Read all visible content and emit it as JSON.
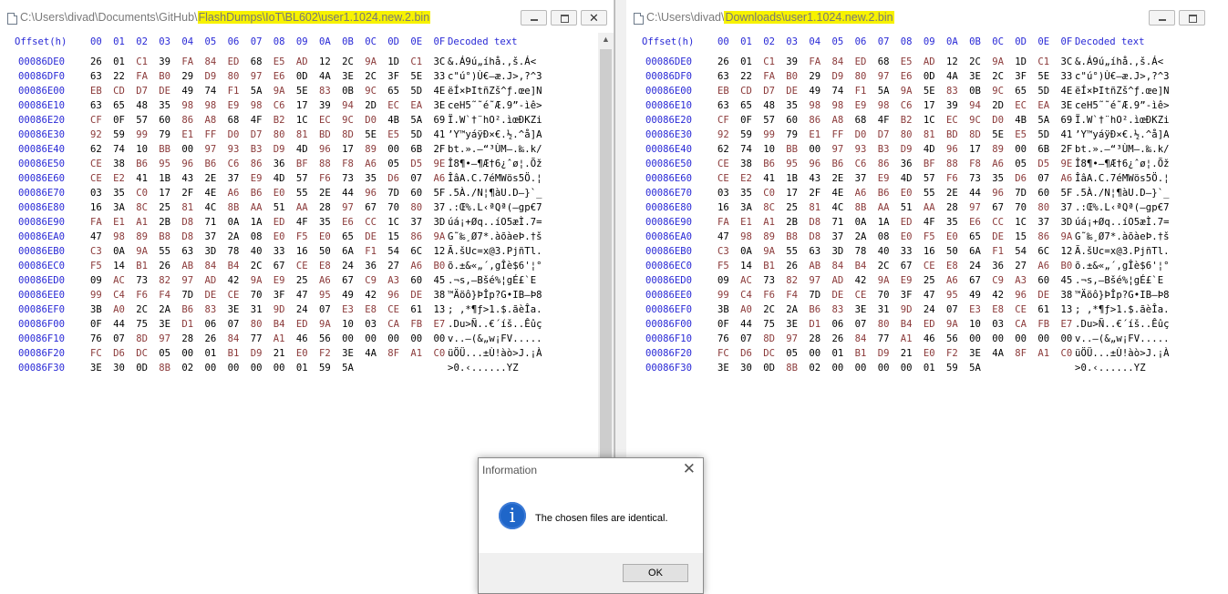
{
  "left_window": {
    "title_prefix": "C:\\Users\\divad\\Documents\\GitHub\\",
    "title_highlight": "FlashDumps\\IoT\\BL602\\user1.1024.new.2.bin"
  },
  "right_window": {
    "title_prefix": "C:\\Users\\divad\\",
    "title_highlight": "Downloads\\user1.1024.new.2.bin"
  },
  "header": {
    "offset": "Offset(h)",
    "columns": [
      "00",
      "01",
      "02",
      "03",
      "04",
      "05",
      "06",
      "07",
      "08",
      "09",
      "0A",
      "0B",
      "0C",
      "0D",
      "0E",
      "0F"
    ],
    "decoded": "Decoded text"
  },
  "rows": [
    {
      "offset": "00086DE0",
      "bytes": [
        "26",
        "01",
        "C1",
        "39",
        "FA",
        "84",
        "ED",
        "68",
        "E5",
        "AD",
        "12",
        "2C",
        "9A",
        "1D",
        "C1",
        "3C"
      ],
      "text": "&.Á9ú„íhå­.,š.Á<"
    },
    {
      "offset": "00086DF0",
      "bytes": [
        "63",
        "22",
        "FA",
        "B0",
        "29",
        "D9",
        "80",
        "97",
        "E6",
        "0D",
        "4A",
        "3E",
        "2C",
        "3F",
        "5E",
        "33"
      ],
      "text": "c\"ú°)Ù€—æ.J>,?^3"
    },
    {
      "offset": "00086E00",
      "bytes": [
        "EB",
        "CD",
        "D7",
        "DE",
        "49",
        "74",
        "F1",
        "5A",
        "9A",
        "5E",
        "83",
        "0B",
        "9C",
        "65",
        "5D",
        "4E"
      ],
      "text": "ëÍ×ÞItñZš^ƒ.œe]N"
    },
    {
      "offset": "00086E10",
      "bytes": [
        "63",
        "65",
        "48",
        "35",
        "98",
        "98",
        "E9",
        "98",
        "C6",
        "17",
        "39",
        "94",
        "2D",
        "EC",
        "EA",
        "3E"
      ],
      "text": "ceH5˜˜é˜Æ.9”-ìê>"
    },
    {
      "offset": "00086E20",
      "bytes": [
        "CF",
        "0F",
        "57",
        "60",
        "86",
        "A8",
        "68",
        "4F",
        "B2",
        "1C",
        "EC",
        "9C",
        "D0",
        "4B",
        "5A",
        "69"
      ],
      "text": "Ï.W`†¨hO².ìœÐKZi"
    },
    {
      "offset": "00086E30",
      "bytes": [
        "92",
        "59",
        "99",
        "79",
        "E1",
        "FF",
        "D0",
        "D7",
        "80",
        "81",
        "BD",
        "8D",
        "5E",
        "E5",
        "5D",
        "41"
      ],
      "text": "’Y™yáÿÐ×€.½.^å]A"
    },
    {
      "offset": "00086E40",
      "bytes": [
        "62",
        "74",
        "10",
        "BB",
        "00",
        "97",
        "93",
        "B3",
        "D9",
        "4D",
        "96",
        "17",
        "89",
        "00",
        "6B",
        "2F"
      ],
      "text": "bt.».—“³ÙM–.‰.k/"
    },
    {
      "offset": "00086E50",
      "bytes": [
        "CE",
        "38",
        "B6",
        "95",
        "96",
        "B6",
        "C6",
        "86",
        "36",
        "BF",
        "88",
        "F8",
        "A6",
        "05",
        "D5",
        "9E"
      ],
      "text": "Î8¶•–¶Æ†6¿ˆø¦.Õž"
    },
    {
      "offset": "00086E60",
      "bytes": [
        "CE",
        "E2",
        "41",
        "1B",
        "43",
        "2E",
        "37",
        "E9",
        "4D",
        "57",
        "F6",
        "73",
        "35",
        "D6",
        "07",
        "A6"
      ],
      "text": "ÎâA.C.7éMWös5Ö.¦"
    },
    {
      "offset": "00086E70",
      "bytes": [
        "03",
        "35",
        "C0",
        "17",
        "2F",
        "4E",
        "A6",
        "B6",
        "E0",
        "55",
        "2E",
        "44",
        "96",
        "7D",
        "60",
        "5F"
      ],
      "text": ".5À./N¦¶àU.D–}`_"
    },
    {
      "offset": "00086E80",
      "bytes": [
        "16",
        "3A",
        "8C",
        "25",
        "81",
        "4C",
        "8B",
        "AA",
        "51",
        "AA",
        "28",
        "97",
        "67",
        "70",
        "80",
        "37"
      ],
      "text": ".:Œ%.L‹ªQª(—gp€7"
    },
    {
      "offset": "00086E90",
      "bytes": [
        "FA",
        "E1",
        "A1",
        "2B",
        "D8",
        "71",
        "0A",
        "1A",
        "ED",
        "4F",
        "35",
        "E6",
        "CC",
        "1C",
        "37",
        "3D"
      ],
      "text": "úá¡+Øq..íO5æÌ.7="
    },
    {
      "offset": "00086EA0",
      "bytes": [
        "47",
        "98",
        "89",
        "B8",
        "D8",
        "37",
        "2A",
        "08",
        "E0",
        "F5",
        "E0",
        "65",
        "DE",
        "15",
        "86",
        "9A"
      ],
      "text": "G˜‰¸Ø7*.àõàeÞ.†š"
    },
    {
      "offset": "00086EB0",
      "bytes": [
        "C3",
        "0A",
        "9A",
        "55",
        "63",
        "3D",
        "78",
        "40",
        "33",
        "16",
        "50",
        "6A",
        "F1",
        "54",
        "6C",
        "12"
      ],
      "text": "Ã.šUc=x@3.PjñTl."
    },
    {
      "offset": "00086EC0",
      "bytes": [
        "F5",
        "14",
        "B1",
        "26",
        "AB",
        "84",
        "B4",
        "2C",
        "67",
        "CE",
        "E8",
        "24",
        "36",
        "27",
        "A6",
        "B0"
      ],
      "text": "õ.±&«„´,gÎè$6'¦°"
    },
    {
      "offset": "00086ED0",
      "bytes": [
        "09",
        "AC",
        "73",
        "82",
        "97",
        "AD",
        "42",
        "9A",
        "E9",
        "25",
        "A6",
        "67",
        "C9",
        "A3",
        "60",
        "45"
      ],
      "text": ".¬s‚—­Bšé%¦gÉ£`E"
    },
    {
      "offset": "00086EE0",
      "bytes": [
        "99",
        "C4",
        "F6",
        "F4",
        "7D",
        "DE",
        "CE",
        "70",
        "3F",
        "47",
        "95",
        "49",
        "42",
        "96",
        "DE",
        "38"
      ],
      "text": "™Äöô}ÞÎp?G•IB–Þ8"
    },
    {
      "offset": "00086EF0",
      "bytes": [
        "3B",
        "A0",
        "2C",
        "2A",
        "B6",
        "83",
        "3E",
        "31",
        "9D",
        "24",
        "07",
        "E3",
        "E8",
        "CE",
        "61",
        "13"
      ],
      "text": "; ,*¶ƒ>1.$.ãèÎa."
    },
    {
      "offset": "00086F00",
      "bytes": [
        "0F",
        "44",
        "75",
        "3E",
        "D1",
        "06",
        "07",
        "80",
        "B4",
        "ED",
        "9A",
        "10",
        "03",
        "CA",
        "FB",
        "E7"
      ],
      "text": ".Du>Ñ..€´íš..Êûç"
    },
    {
      "offset": "00086F10",
      "bytes": [
        "76",
        "07",
        "8D",
        "97",
        "28",
        "26",
        "84",
        "77",
        "A1",
        "46",
        "56",
        "00",
        "00",
        "00",
        "00",
        "00"
      ],
      "text": "v..—(&„w¡FV....."
    },
    {
      "offset": "00086F20",
      "bytes": [
        "FC",
        "D6",
        "DC",
        "05",
        "00",
        "01",
        "B1",
        "D9",
        "21",
        "E0",
        "F2",
        "3E",
        "4A",
        "8F",
        "A1",
        "C0"
      ],
      "text": "üÖÜ...±Ù!àò>J.¡À"
    },
    {
      "offset": "00086F30",
      "bytes": [
        "3E",
        "30",
        "0D",
        "8B",
        "02",
        "00",
        "00",
        "00",
        "00",
        "01",
        "59",
        "5A"
      ],
      "text": ">0.‹......YZ"
    }
  ],
  "dialog": {
    "title": "Information",
    "message": "The chosen files are identical.",
    "ok_label": "OK",
    "icon": "info-icon",
    "accent": "#1f66c9"
  },
  "colors": {
    "offset_and_header": "#2929d6",
    "byte_high": "#8b3a3a",
    "title_highlight": "#f7f200"
  }
}
